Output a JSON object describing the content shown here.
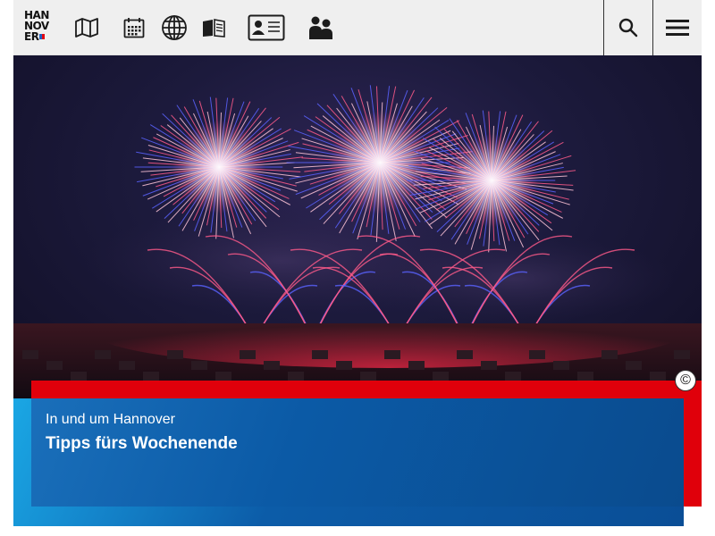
{
  "header": {
    "logo": {
      "line1": "HAN",
      "line2": "NOV",
      "line3": "ER"
    },
    "icons": [
      "map-icon",
      "calendar-icon",
      "globe-icon",
      "book-icon",
      "contact-card-icon",
      "people-icon"
    ],
    "search_icon": "search-icon",
    "menu_icon": "hamburger-menu-icon"
  },
  "hero": {
    "copyright_symbol": "©"
  },
  "teaser": {
    "kicker": "In und um Hannover",
    "title": "Tipps fürs Wochenende"
  },
  "colors": {
    "header_bg": "#efefef",
    "accent_red": "#e0000b",
    "teaser_blue": "#0b5aa6",
    "teaser_light_blue": "#1aa7e4",
    "firework_pink": "#ff5a8a",
    "firework_blue": "#5a63ff"
  }
}
